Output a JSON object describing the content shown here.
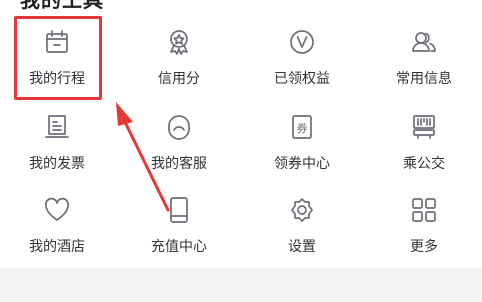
{
  "header": {
    "title": "我的工具"
  },
  "items": [
    {
      "label": "我的行程",
      "icon": "calendar-icon"
    },
    {
      "label": "信用分",
      "icon": "medal-icon"
    },
    {
      "label": "已领权益",
      "icon": "v-circle-icon"
    },
    {
      "label": "常用信息",
      "icon": "people-icon"
    },
    {
      "label": "我的发票",
      "icon": "invoice-icon"
    },
    {
      "label": "我的客服",
      "icon": "headset-icon"
    },
    {
      "label": "领券中心",
      "icon": "coupon-icon"
    },
    {
      "label": "乘公交",
      "icon": "bus-code-icon"
    },
    {
      "label": "我的酒店",
      "icon": "heart-icon"
    },
    {
      "label": "充值中心",
      "icon": "phone-icon"
    },
    {
      "label": "设置",
      "icon": "gear-icon"
    },
    {
      "label": "更多",
      "icon": "grid-icon"
    }
  ],
  "colors": {
    "accent": "#e53935",
    "icon": "#6b6f78",
    "footer": "#f3f4f6"
  }
}
